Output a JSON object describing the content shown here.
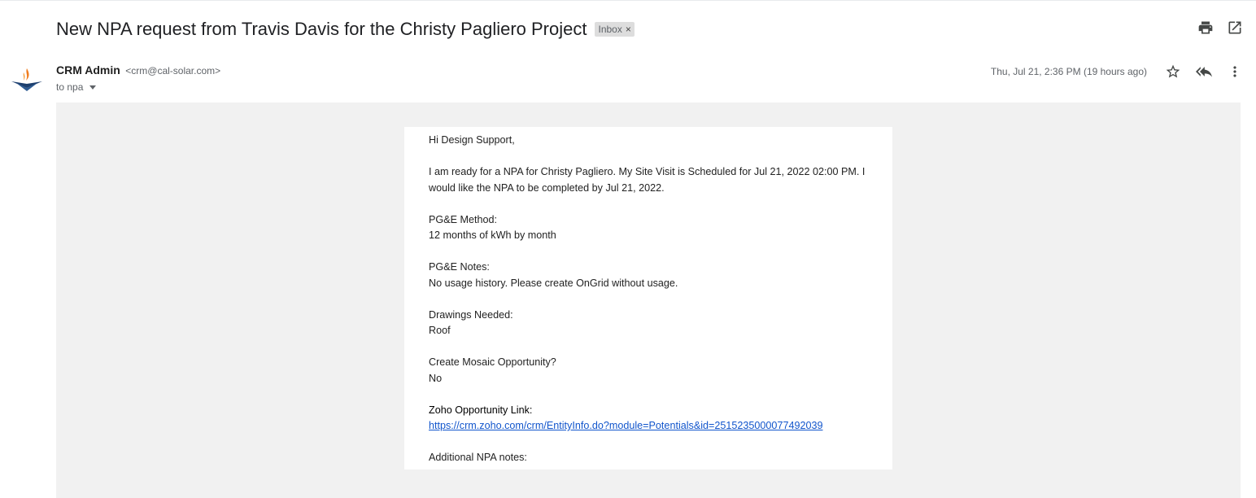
{
  "email": {
    "subject": "New NPA request from Travis Davis for the Christy Pagliero Project",
    "label": "Inbox",
    "label_remove": "×",
    "sender_name": "CRM Admin",
    "sender_email": "<crm@cal-solar.com>",
    "to_line": "to npa",
    "date": "Thu, Jul 21, 2:36 PM (19 hours ago)"
  },
  "icons": {
    "print": "print-icon",
    "open_new_window": "open-in-new-icon",
    "star": "star-icon",
    "reply_all": "reply-all-icon",
    "more": "more-vert-icon",
    "avatar": "cal-solar-logo"
  },
  "body": {
    "greeting": "Hi Design Support,",
    "intro": "I am ready for a NPA for Christy Pagliero. My Site Visit is Scheduled for Jul 21, 2022 02:00 PM. I would like the NPA to be completed by Jul 21, 2022.",
    "pge_method_label": "PG&E Method:",
    "pge_method_value": "12 months of kWh by month",
    "pge_notes_label": "PG&E Notes:",
    "pge_notes_value": "No usage history. Please create OnGrid without usage.",
    "drawings_label": "Drawings Needed:",
    "drawings_value": "Roof",
    "mosaic_label": "Create Mosaic Opportunity?",
    "mosaic_value": "No",
    "zoho_label": "Zoho Opportunity Link:",
    "zoho_link": "https://crm.zoho.com/crm/EntityInfo.do?module=Potentials&id=2515235000077492039",
    "additional_label": "Additional NPA notes:"
  },
  "colors": {
    "link": "#1155cc",
    "body_background": "#f1f1f1",
    "label_chip": "#dddddd",
    "logo_blue": "#1d3f6e",
    "logo_orange": "#f07c1e"
  }
}
